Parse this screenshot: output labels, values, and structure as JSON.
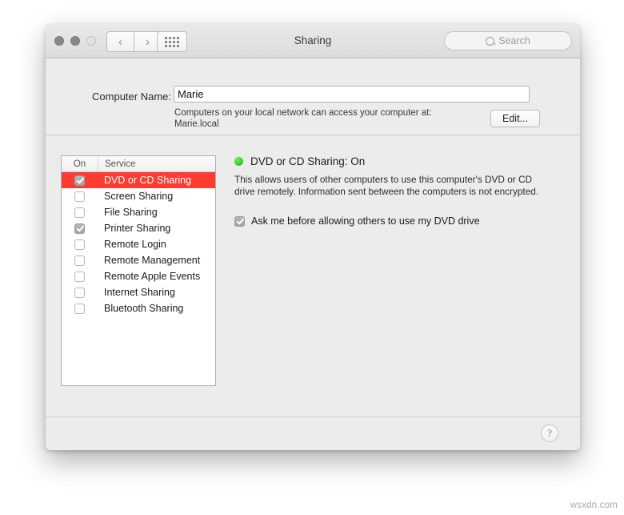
{
  "window": {
    "title": "Sharing",
    "traffic_lights": [
      "close",
      "minimize",
      "zoom"
    ],
    "nav": {
      "back": "‹",
      "forward": "›"
    },
    "grid_button": "all-preferences",
    "search": {
      "placeholder": "Search",
      "value": ""
    }
  },
  "top": {
    "computer_name_label": "Computer Name:",
    "computer_name_value": "Marie",
    "network_note_line1": "Computers on your local network can access your computer at:",
    "network_note_line2": "Marie.local",
    "edit_button": "Edit..."
  },
  "service_list": {
    "header": {
      "on": "On",
      "service": "Service"
    },
    "rows": [
      {
        "label": "DVD or CD Sharing",
        "checked": true,
        "selected": true
      },
      {
        "label": "Screen Sharing",
        "checked": false,
        "selected": false
      },
      {
        "label": "File Sharing",
        "checked": false,
        "selected": false
      },
      {
        "label": "Printer Sharing",
        "checked": true,
        "selected": false
      },
      {
        "label": "Remote Login",
        "checked": false,
        "selected": false
      },
      {
        "label": "Remote Management",
        "checked": false,
        "selected": false
      },
      {
        "label": "Remote Apple Events",
        "checked": false,
        "selected": false
      },
      {
        "label": "Internet Sharing",
        "checked": false,
        "selected": false
      },
      {
        "label": "Bluetooth Sharing",
        "checked": false,
        "selected": false
      }
    ]
  },
  "detail": {
    "status_title": "DVD or CD Sharing: On",
    "status_color": "#2ec41f",
    "description": "This allows users of other computers to use this computer's DVD or CD drive remotely. Information sent between the computers is not encrypted.",
    "option_label": "Ask me before allowing others to use my DVD drive",
    "option_checked": true
  },
  "footer": {
    "help_button": "?"
  },
  "watermark": "wsxdn.com",
  "colors": {
    "selection_red": "#fc3b32",
    "status_green": "#2ec41f",
    "window_bg": "#ececec",
    "help_blue": "#4a7fc4"
  }
}
